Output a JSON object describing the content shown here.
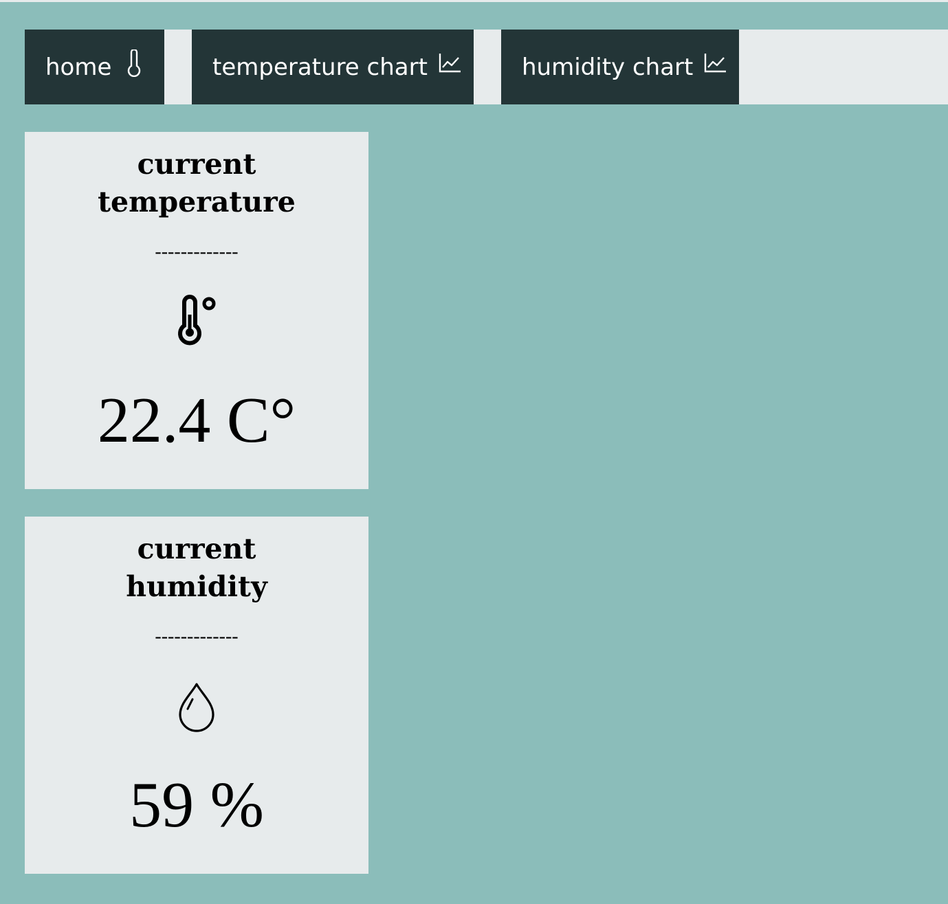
{
  "nav": {
    "items": [
      {
        "label": "home",
        "icon": "thermometer-icon"
      },
      {
        "label": "temperature chart",
        "icon": "line-chart-icon"
      },
      {
        "label": "humidity chart",
        "icon": "line-chart-icon"
      }
    ]
  },
  "cards": {
    "temperature": {
      "title_line1": "current",
      "title_line2": "temperature",
      "divider": "-------------",
      "icon": "thermometer-degree-icon",
      "value": "22.4 C°"
    },
    "humidity": {
      "title_line1": "current",
      "title_line2": "humidity",
      "divider": "-------------",
      "icon": "water-drop-icon",
      "value": "59 %"
    }
  },
  "colors": {
    "background": "#8bbdba",
    "navbar_bg": "#e7ebec",
    "nav_item_bg": "#233537",
    "card_bg": "#e7ebec",
    "text": "#000000"
  }
}
